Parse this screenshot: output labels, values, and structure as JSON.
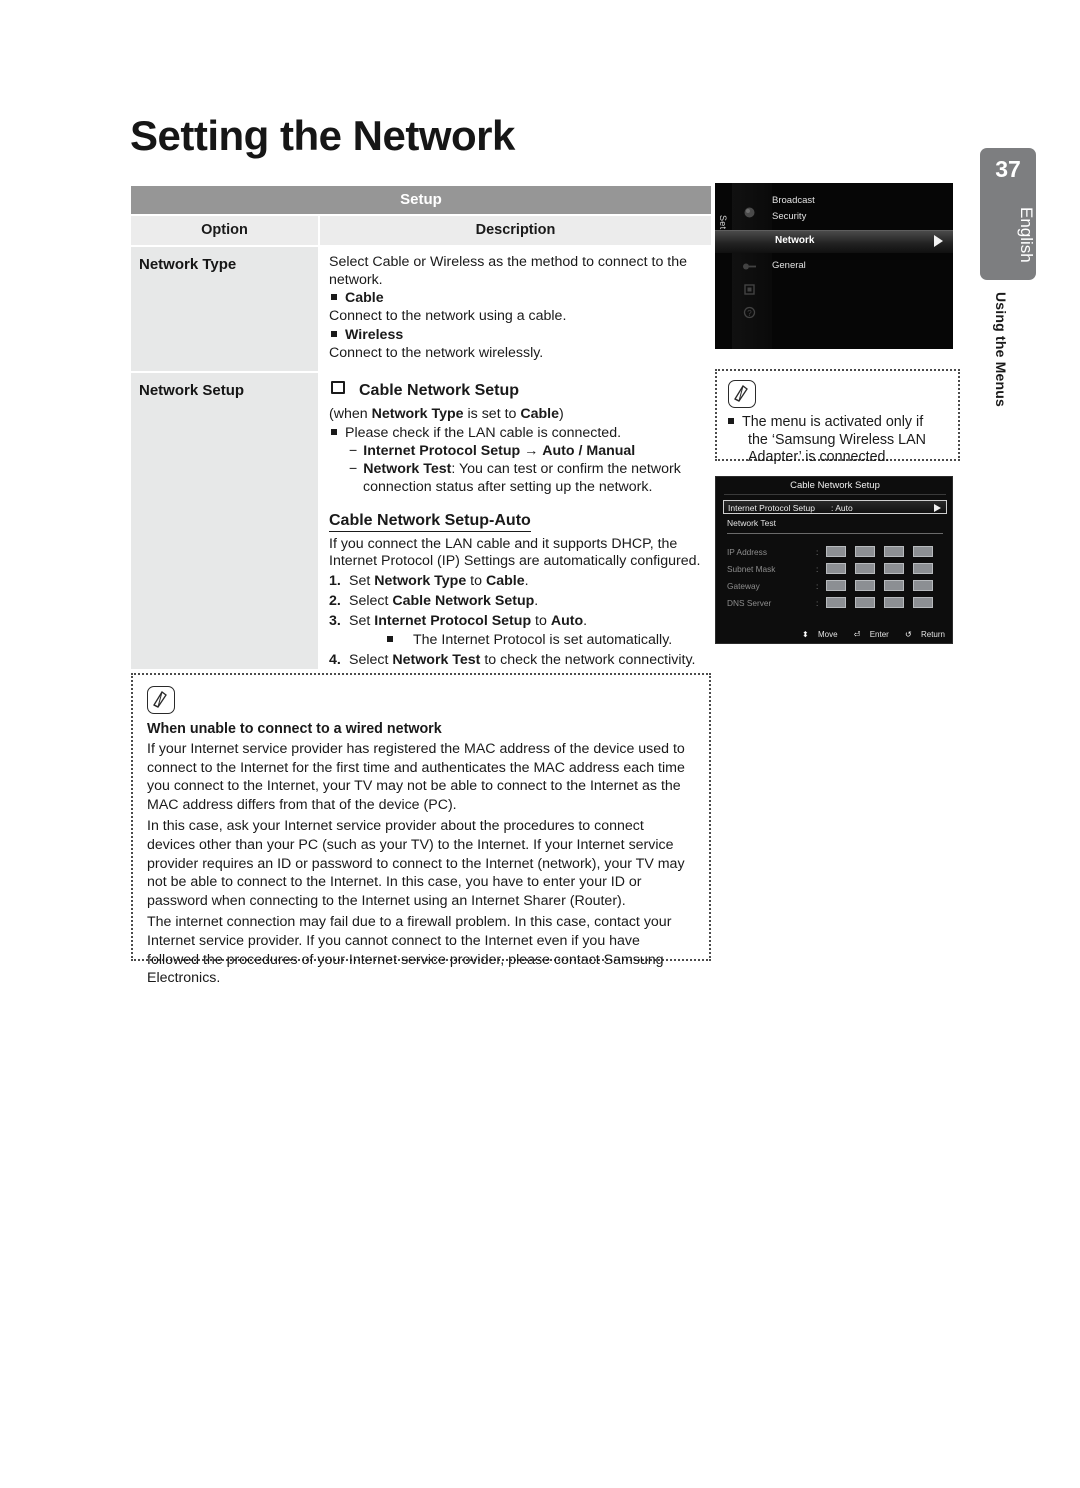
{
  "page": {
    "title": "Setting the Network",
    "number": "37",
    "language": "English",
    "chapter": "Using the Menus"
  },
  "table": {
    "title": "Setup",
    "headers": {
      "option": "Option",
      "description": "Description"
    },
    "rows": [
      {
        "option": "Network Type",
        "intro": "Select Cable or Wireless as the method to connect to the network.",
        "items": [
          {
            "head": "Cable",
            "text": "Connect to the network using a cable."
          },
          {
            "head": "Wireless",
            "text": "Connect to the network wirelessly."
          }
        ]
      },
      {
        "option": "Network Setup",
        "hollow_head": "Cable Network Setup",
        "condition_pre": "(when ",
        "condition_b1": "Network Type",
        "condition_mid": " is set to ",
        "condition_b2": "Cable",
        "condition_post": ")",
        "bullet": "Please check if the LAN cable is connected.",
        "dash1_b": "Internet Protocol Setup",
        "dash1_arrow": "→",
        "dash1_b2": "Auto / Manual",
        "dash2_b": "Network Test",
        "dash2_text": ": You can test or confirm the network connection status after setting up the network.",
        "sub_title": "Cable Network Setup-Auto",
        "sub_intro": "If you connect the LAN cable and it supports DHCP, the Internet Protocol (IP) Settings are automatically configured.",
        "steps": [
          {
            "n": "1.",
            "pre": "Set ",
            "b1": "Network Type",
            "mid": " to ",
            "b2": "Cable",
            "post": "."
          },
          {
            "n": "2.",
            "pre": "Select ",
            "b1": "Cable Network Setup",
            "mid": "",
            "b2": "",
            "post": "."
          },
          {
            "n": "3.",
            "pre": "Set ",
            "b1": "Internet Protocol Setup",
            "mid": " to ",
            "b2": "Auto",
            "post": "."
          },
          {
            "n": "4.",
            "pre": "Select ",
            "b1": "Network Test",
            "mid": " to check the network connectivity",
            "b2": "",
            "post": "."
          }
        ],
        "step3_sub": "The Internet Protocol is set automatically."
      }
    ]
  },
  "note_main": {
    "heading": "When unable to connect to a wired network",
    "paragraphs": [
      "If your Internet service provider has registered the MAC address of the device used to connect to the Internet for the first time and authenticates the MAC address each time you connect to the Internet, your TV may not be able to connect to the Internet as the MAC address differs from that of the device (PC).",
      "In this case, ask your Internet service provider about the procedures to connect devices other than your PC (such as your TV) to the Internet. If your Internet service provider requires an ID or password to connect to the Internet (network), your TV may not be able to connect to the Internet. In this case, you have to enter your ID or password when connecting to the Internet using an Internet Sharer (Router).",
      "The internet connection may fail due to a firewall problem. In this case, contact your Internet service provider. If you cannot connect to the Internet even if you have followed the procedures of your Internet service provider, please contact Samsung Electronics."
    ]
  },
  "note_side": {
    "item": "The menu is activated only if the ‘Samsung Wireless LAN Adapter’ is connected."
  },
  "tv_menu": {
    "rail_label": "Setup",
    "items": [
      {
        "label": "Broadcast",
        "selected": false
      },
      {
        "label": "Security",
        "selected": false
      },
      {
        "label": "Network",
        "selected": true
      },
      {
        "label": "General",
        "selected": false
      }
    ],
    "arrow_glyph": "▶"
  },
  "tv_dialog": {
    "title": "Cable Network Setup",
    "ip_setup_label": "Internet Protocol Setup",
    "ip_setup_value": ": Auto",
    "network_test": "Network Test",
    "fields": [
      {
        "label": "IP Address",
        "colon": ":"
      },
      {
        "label": "Subnet Mask",
        "colon": ":"
      },
      {
        "label": "Gateway",
        "colon": ":"
      },
      {
        "label": "DNS Server",
        "colon": ":"
      }
    ],
    "footer": {
      "move": "Move",
      "move_glyph": "⬍",
      "enter": "Enter",
      "enter_glyph": "⏎",
      "return": "Return",
      "return_glyph": "↺"
    }
  },
  "colors": {
    "table_title_bg": "#969696",
    "table_head_bg": "#ececec",
    "option_cell_bg": "#e7e8e8",
    "page_tab_bg": "#7d7e80"
  }
}
